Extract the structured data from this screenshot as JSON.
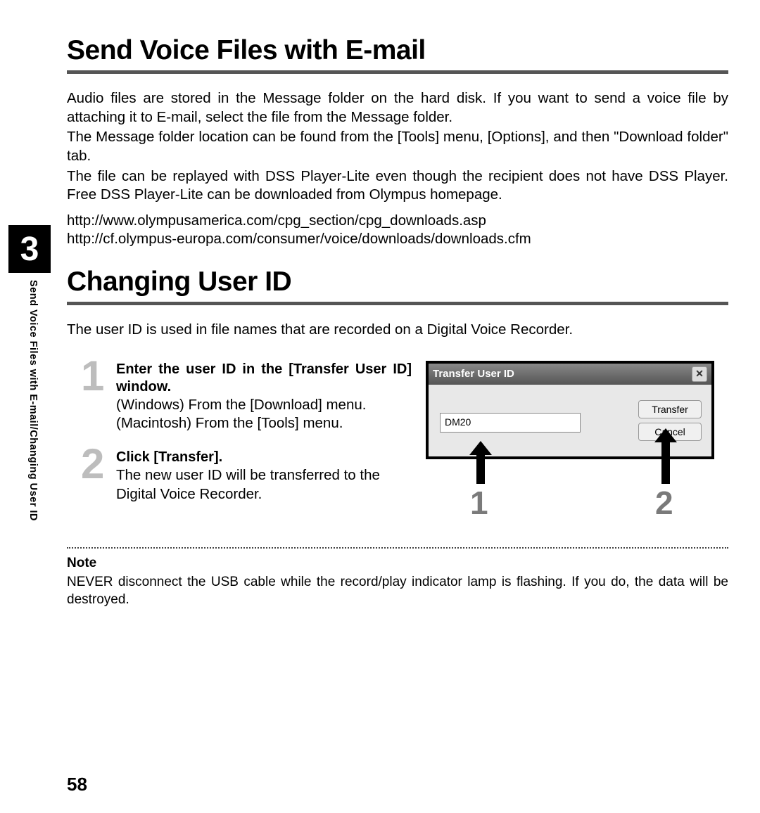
{
  "chapter_number": "3",
  "side_label": "Send Voice Files with E-mail/Changing User ID",
  "page_number": "58",
  "section1": {
    "title": "Send Voice Files with E-mail",
    "para1": "Audio files are stored in the Message folder on the hard disk. If you want to send a voice file by attaching it to E-mail, select the file from the Message folder.",
    "para2": "The Message folder location can be found from the [Tools] menu, [Options], and then \"Download folder\" tab.",
    "para3": "The file can be replayed with DSS Player-Lite even though the recipient does not have DSS Player. Free DSS Player-Lite can be downloaded from Olympus homepage.",
    "url1": "http://www.olympusamerica.com/cpg_section/cpg_downloads.asp",
    "url2": "http://cf.olympus-europa.com/consumer/voice/downloads/downloads.cfm"
  },
  "section2": {
    "title": "Changing User ID",
    "intro": "The user ID is used in file names that are recorded on a Digital Voice Recorder.",
    "steps": [
      {
        "num": "1",
        "title": "Enter the user ID in the [Transfer User ID] window.",
        "body_a": "(Windows) From the [Download] menu.",
        "body_b": "(Macintosh) From the [Tools] menu."
      },
      {
        "num": "2",
        "title": "Click [Transfer].",
        "body": "The new user ID will be transferred to the Digital Voice Recorder."
      }
    ],
    "dialog": {
      "title": "Transfer User ID",
      "input_value": "DM20",
      "transfer_btn": "Transfer",
      "cancel_btn": "Cancel",
      "callout1": "1",
      "callout2": "2"
    },
    "note_head": "Note",
    "note_body": "NEVER disconnect the USB cable while the record/play indicator lamp is flashing. If you do, the data will be destroyed."
  }
}
